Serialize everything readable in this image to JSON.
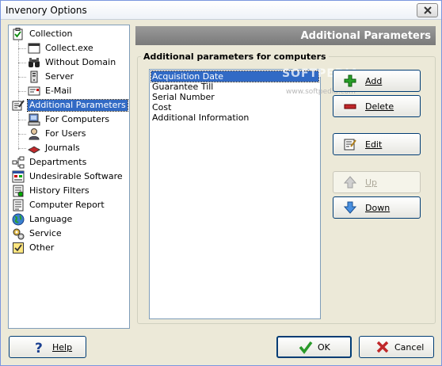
{
  "window": {
    "title": "Invenory Options"
  },
  "tree": {
    "items": [
      {
        "label": "Collection",
        "icon": "checklist-icon"
      },
      {
        "label": "Collect.exe",
        "icon": "window-icon"
      },
      {
        "label": "Without Domain",
        "icon": "binoculars-icon"
      },
      {
        "label": "Server",
        "icon": "server-icon"
      },
      {
        "label": "E-Mail",
        "icon": "email-icon"
      },
      {
        "label": "Additional Parameters",
        "icon": "edit-note-icon"
      },
      {
        "label": "For Computers",
        "icon": "computer-icon"
      },
      {
        "label": "For Users",
        "icon": "user-icon"
      },
      {
        "label": "Journals",
        "icon": "journal-icon"
      },
      {
        "label": "Departments",
        "icon": "departments-icon"
      },
      {
        "label": "Undesirable Software",
        "icon": "software-icon"
      },
      {
        "label": "History Filters",
        "icon": "history-icon"
      },
      {
        "label": "Computer Report",
        "icon": "report-icon"
      },
      {
        "label": "Language",
        "icon": "globe-icon"
      },
      {
        "label": "Service",
        "icon": "gears-icon"
      },
      {
        "label": "Other",
        "icon": "check-box-icon"
      }
    ],
    "selected": "Additional Parameters"
  },
  "panel": {
    "header": "Additional Parameters",
    "group_title": "Additional parameters for computers",
    "list": [
      "Acquisition Date",
      "Guarantee Till",
      "Serial Number",
      "Cost",
      "Additional Information"
    ],
    "selected_index": 0,
    "watermark": "SOFTPEDIA",
    "watermark_url": "www.softpedia.com"
  },
  "buttons": {
    "add": "Add",
    "delete": "Delete",
    "edit": "Edit",
    "up": "Up",
    "down": "Down",
    "help": "Help",
    "ok": "OK",
    "cancel": "Cancel"
  },
  "colors": {
    "selection": "#316ac5",
    "header_bg": "#8a8a8a",
    "dialog_bg": "#ece9d8"
  }
}
